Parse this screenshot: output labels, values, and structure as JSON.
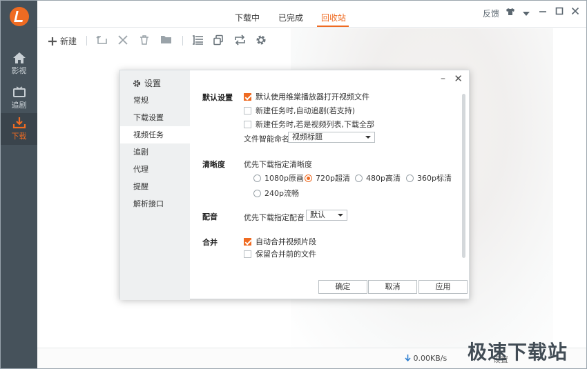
{
  "nav": {
    "items": [
      {
        "label": "影视",
        "icon": "home-icon"
      },
      {
        "label": "追剧",
        "icon": "tv-icon"
      },
      {
        "label": "下载",
        "icon": "download-icon"
      }
    ]
  },
  "tabs": [
    "下载中",
    "已完成",
    "回收站"
  ],
  "active_tab": "回收站",
  "window": {
    "feedback": "反馈"
  },
  "toolbar": {
    "new_label": "新建"
  },
  "dialog": {
    "title": "设置",
    "menu": [
      "常规",
      "下载设置",
      "视频任务",
      "追剧",
      "代理",
      "提醒",
      "解析接口"
    ],
    "active_menu": "视频任务",
    "default_settings": {
      "label": "默认设置",
      "options": [
        {
          "text": "默认使用维棠播放器打开视频文件",
          "checked": true
        },
        {
          "text": "新建任务时,自动追剧(若支持)",
          "checked": false
        },
        {
          "text": "新建任务时,若是视频列表,下载全部",
          "checked": false
        }
      ],
      "naming_label": "文件智能命名",
      "naming_value": "视频标题"
    },
    "resolution": {
      "label": "清晰度",
      "prompt": "优先下载指定清晰度",
      "options": [
        "1080p原画",
        "720p超清",
        "480p高清",
        "360p标清",
        "240p流畅"
      ],
      "selected": "720p超清"
    },
    "dubbing": {
      "label": "配音",
      "prompt": "优先下载指定配音",
      "value": "默认"
    },
    "merge": {
      "label": "合并",
      "options": [
        {
          "text": "自动合并视频片段",
          "checked": true
        },
        {
          "text": "保留合并前的文件",
          "checked": false
        }
      ]
    },
    "buttons": {
      "ok": "确定",
      "cancel": "取消",
      "apply": "应用"
    }
  },
  "status": {
    "speed": "0.00KB/s",
    "settings": "设置"
  },
  "watermark": "极速下载站",
  "colors": {
    "accent": "#ef6b22",
    "sidebar": "#46525b"
  }
}
